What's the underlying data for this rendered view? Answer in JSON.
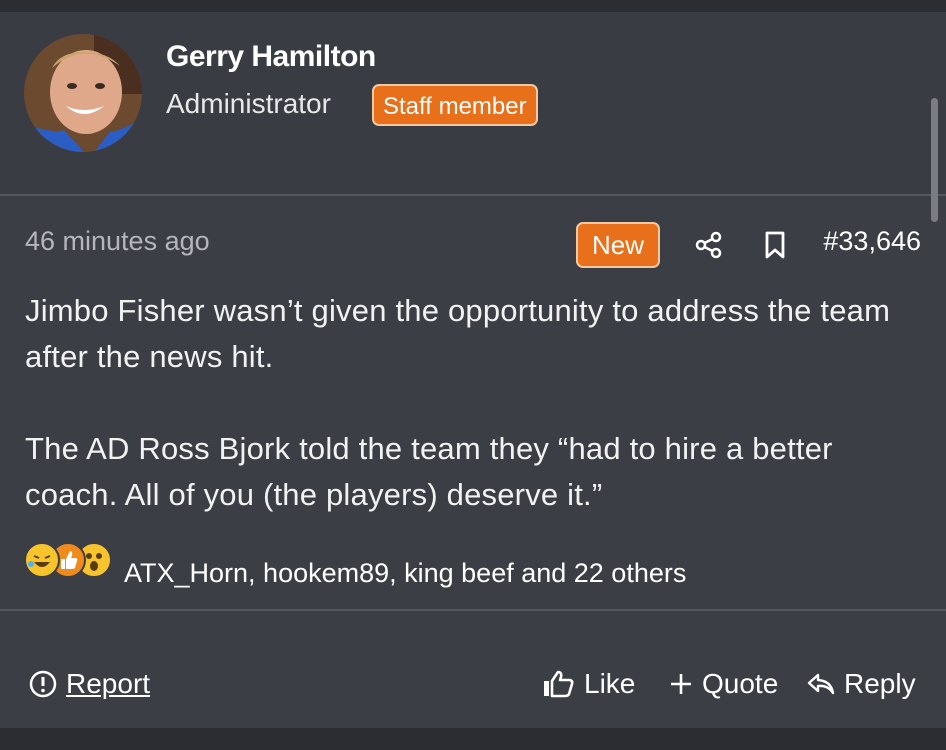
{
  "post": {
    "author": {
      "name": "Gerry Hamilton",
      "title": "Administrator",
      "badge": "Staff member",
      "avatar_icon": "user-avatar-photo"
    },
    "timestamp": "46 minutes ago",
    "new_label": "New",
    "post_number": "#33,646",
    "message": {
      "paragraphs": [
        "Jimbo Fisher wasn’t given the opportunity to address the team after the news hit.",
        "The AD Ross Bjork told the team they “had to hire a better coach. All of you (the players) deserve it.”"
      ]
    },
    "reactions": {
      "icons": [
        "laughing-emoji-icon",
        "thumbs-up-icon",
        "shocked-emoji-icon"
      ],
      "users_text": "ATX_Horn, hookem89, king beef and 22 others"
    },
    "actions": {
      "report": "Report",
      "like": "Like",
      "quote": "Quote",
      "reply": "Reply"
    }
  },
  "colors": {
    "accent": "#e8701a",
    "background": "#3c3e45",
    "text": "#f2f2f2"
  }
}
